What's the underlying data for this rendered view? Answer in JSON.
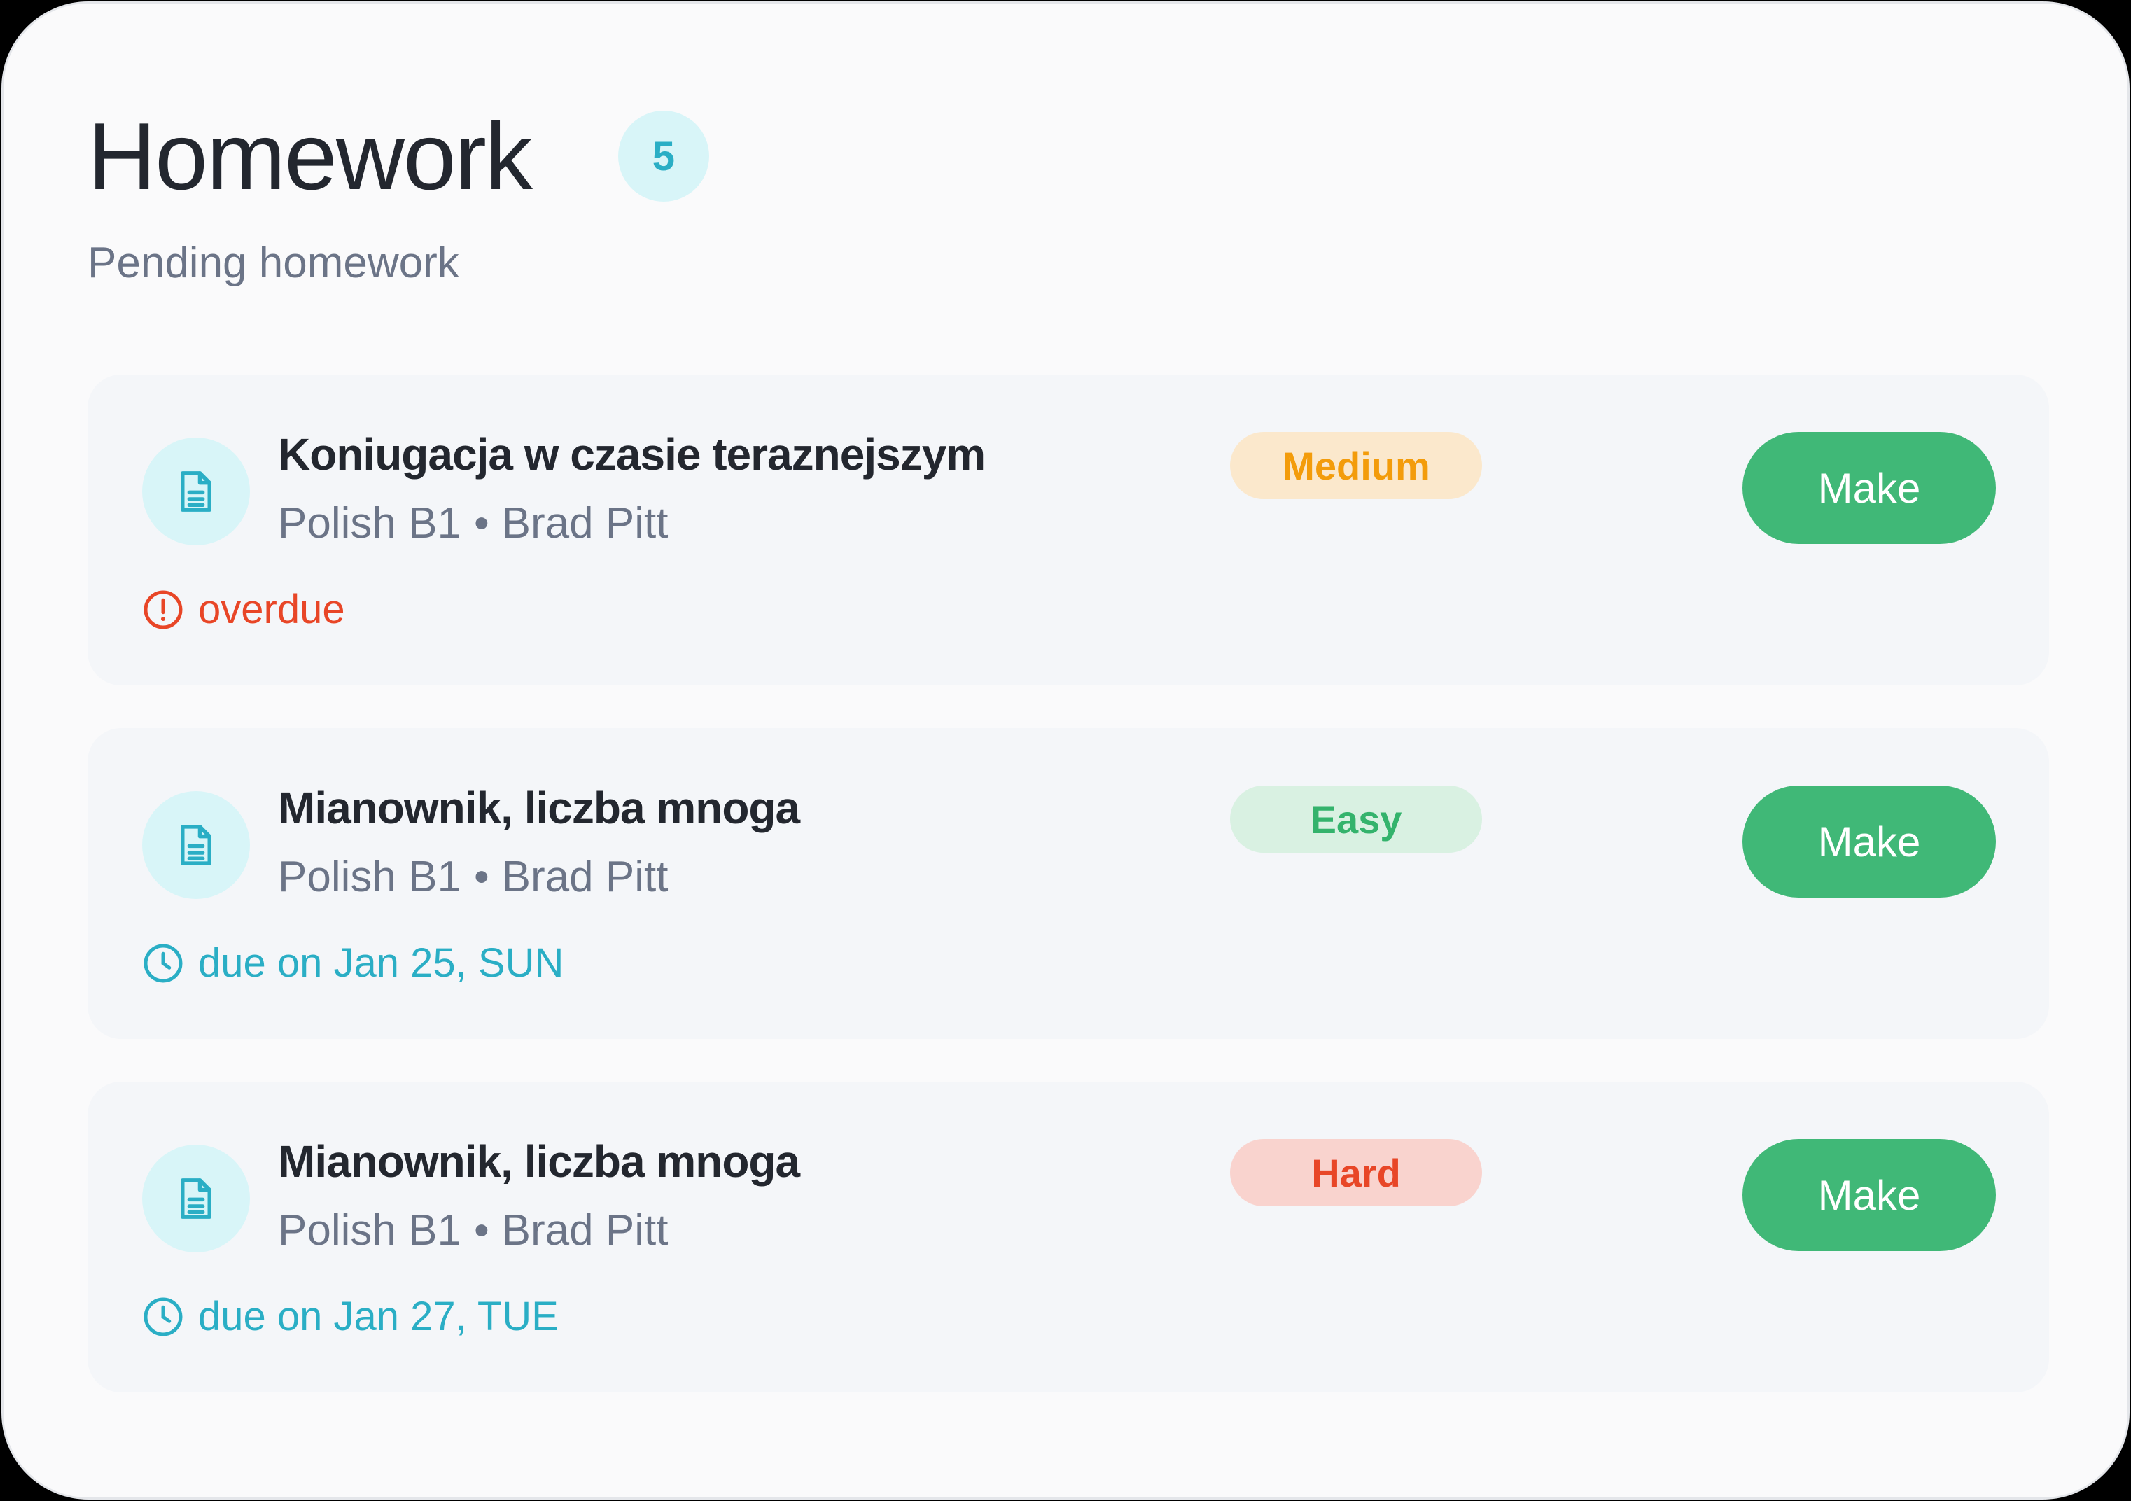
{
  "header": {
    "title": "Homework",
    "count": "5",
    "subtitle": "Pending homework"
  },
  "colors": {
    "accent_teal": "#2aaec5",
    "make_button": "#40b877",
    "overdue_red": "#e84627",
    "medium_orange": "#f39c0b",
    "easy_green": "#34b36c"
  },
  "homework": [
    {
      "title": "Koniugacja w czasie teraznejszym",
      "course": "Polish B1",
      "separator": "•",
      "teacher": "Brad Pitt",
      "difficulty": "Medium",
      "status_icon": "alert-circle-icon",
      "status": "overdue",
      "button_label": "Make"
    },
    {
      "title": "Mianownik, liczba mnoga",
      "course": "Polish B1",
      "separator": "•",
      "teacher": "Brad Pitt",
      "difficulty": "Easy",
      "status_icon": "clock-icon",
      "status": "due on Jan 25, SUN",
      "button_label": "Make"
    },
    {
      "title": "Mianownik, liczba mnoga",
      "course": "Polish B1",
      "separator": "•",
      "teacher": "Brad Pitt",
      "difficulty": "Hard",
      "status_icon": "clock-icon",
      "status": "due on Jan 27, TUE",
      "button_label": "Make"
    }
  ]
}
